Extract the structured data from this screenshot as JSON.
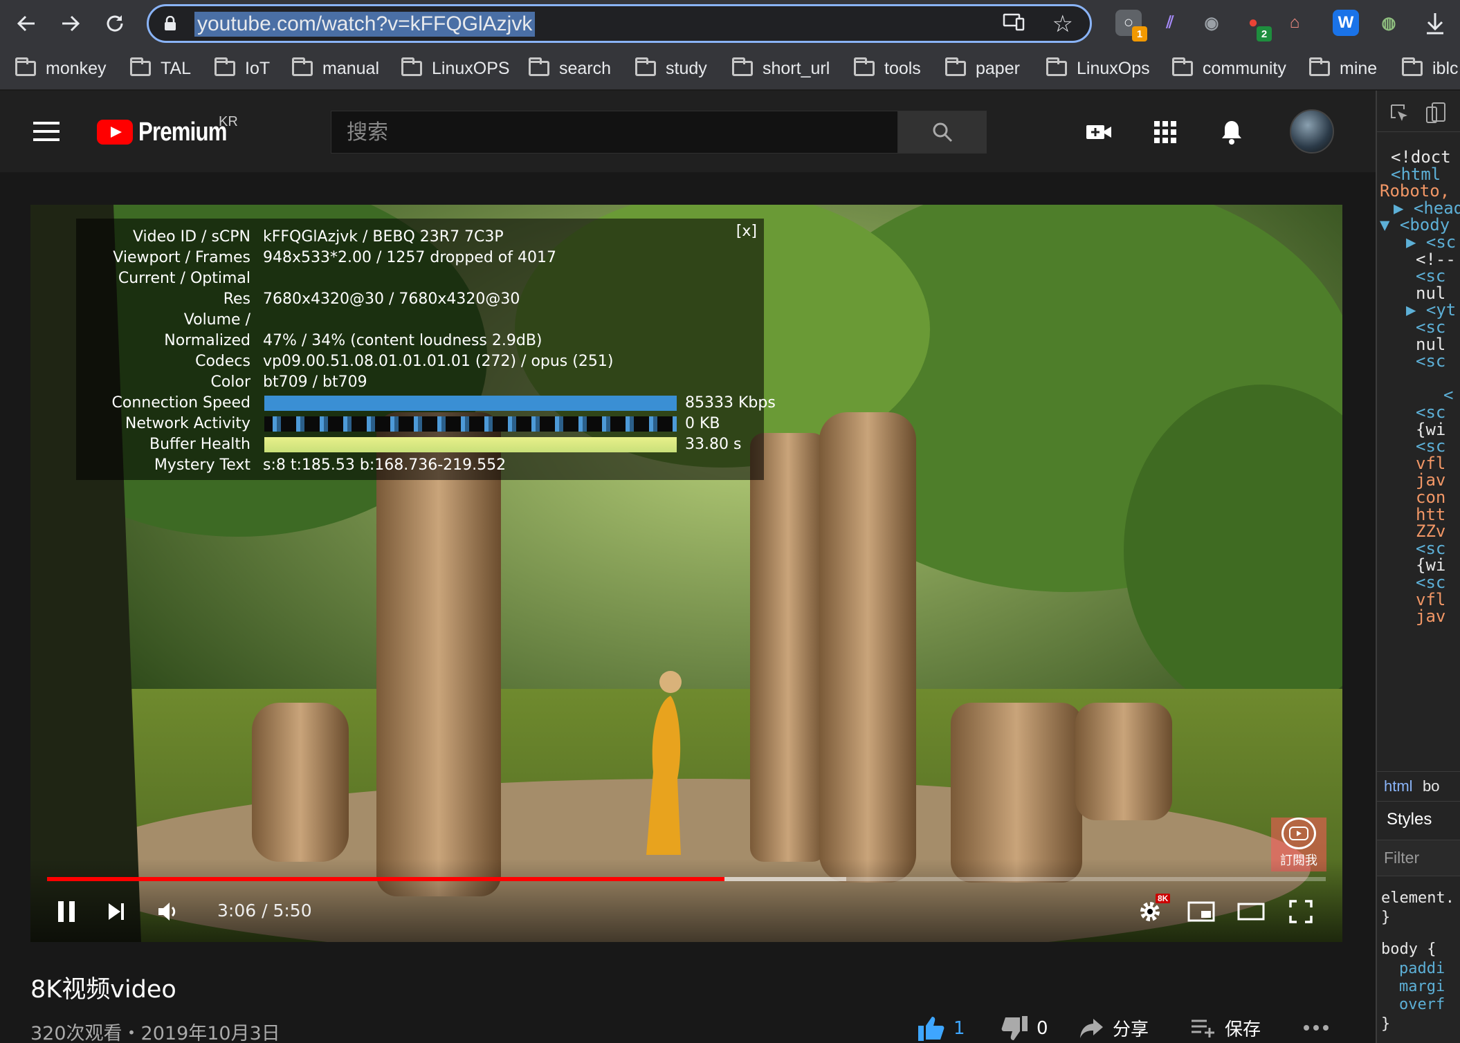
{
  "browser": {
    "url": "youtube.com/watch?v=kFFQGlAzjvk",
    "extensions": [
      {
        "icon": "key-search-icon",
        "badge": "1",
        "badge_color": "#f29900"
      },
      {
        "icon": "stripes-icon",
        "badge": ""
      },
      {
        "icon": "camera-icon",
        "badge": ""
      },
      {
        "icon": "balloon-icon",
        "badge": "2",
        "badge_color": "#1e8e3e"
      },
      {
        "icon": "cat-icon",
        "badge": ""
      },
      {
        "icon": "w-icon",
        "badge": ""
      },
      {
        "icon": "tea-icon",
        "badge": ""
      }
    ],
    "bookmarks": [
      "monkey",
      "TAL",
      "IoT",
      "manual",
      "LinuxOPS",
      "search",
      "study",
      "short_url",
      "tools",
      "paper",
      "LinuxOps",
      "community",
      "mine",
      "iblc"
    ]
  },
  "masthead": {
    "logo_text": "Premium",
    "region": "KR",
    "search_placeholder": "搜索"
  },
  "stats": {
    "close": "[x]",
    "rows": [
      {
        "label": "Video ID / sCPN",
        "value": "kFFQGlAzjvk / BEBQ 23R7 7C3P"
      },
      {
        "label": "Viewport / Frames",
        "value": "948x533*2.00 / 1257 dropped of 4017"
      },
      {
        "label": "Current / Optimal",
        "value": ""
      },
      {
        "label": "Res",
        "value": "7680x4320@30 / 7680x4320@30"
      },
      {
        "label": "Volume /",
        "value": ""
      },
      {
        "label": "Normalized",
        "value": "47% / 34% (content loudness 2.9dB)"
      },
      {
        "label": "Codecs",
        "value": "vp09.00.51.08.01.01.01.01 (272) / opus (251)"
      },
      {
        "label": "Color",
        "value": "bt709 / bt709"
      },
      {
        "label": "Connection Speed",
        "value": "85333 Kbps"
      },
      {
        "label": "Network Activity",
        "value": "0 KB"
      },
      {
        "label": "Buffer Health",
        "value": "33.80 s"
      },
      {
        "label": "Mystery Text",
        "value": "s:8 t:185.53 b:168.736-219.552"
      }
    ]
  },
  "player": {
    "time": "3:06 / 5:50",
    "played_fraction": 0.53,
    "buffered_fraction": 0.625,
    "quality_badge": "8K",
    "watermark_text": "訂閱我",
    "accent": "#ff0000"
  },
  "video": {
    "title": "8K视频video",
    "meta": "320次观看・2019年10月3日",
    "likes": "1",
    "dislikes": "0",
    "share": "分享",
    "save": "保存"
  },
  "devtools": {
    "lines": [
      {
        "text": "<!doct",
        "cls": "txt"
      },
      {
        "text": "<html",
        "cls": "tag"
      },
      {
        "text": "Roboto,",
        "cls": "str"
      },
      {
        "text": "▶ <head",
        "cls": "tag"
      },
      {
        "text": "▼ <body",
        "cls": "tag"
      },
      {
        "text": "▶ <sc",
        "cls": "tag"
      },
      {
        "text": "<!--",
        "cls": "txt"
      },
      {
        "text": "<sc",
        "cls": "tag"
      },
      {
        "text": "nul",
        "cls": "txt"
      },
      {
        "text": "▶ <yt",
        "cls": "tag"
      },
      {
        "text": "<sc",
        "cls": "tag"
      },
      {
        "text": "nul",
        "cls": "txt"
      },
      {
        "text": "<sc",
        "cls": "tag"
      },
      {
        "text": "",
        "cls": "txt"
      },
      {
        "text": "<",
        "cls": "tag"
      },
      {
        "text": "<sc",
        "cls": "tag"
      },
      {
        "text": "{wi",
        "cls": "txt"
      },
      {
        "text": "<sc",
        "cls": "tag"
      },
      {
        "text": "vfl",
        "cls": "str"
      },
      {
        "text": "jav",
        "cls": "str"
      },
      {
        "text": "con",
        "cls": "str"
      },
      {
        "text": "htt",
        "cls": "str"
      },
      {
        "text": "ZZv",
        "cls": "str"
      },
      {
        "text": "<sc",
        "cls": "tag"
      },
      {
        "text": "{wi",
        "cls": "txt"
      },
      {
        "text": "<sc",
        "cls": "tag"
      },
      {
        "text": "vfl",
        "cls": "str"
      },
      {
        "text": "jav",
        "cls": "str"
      }
    ],
    "crumbs": [
      "html",
      "bo"
    ],
    "styles_tab": "Styles",
    "filter_placeholder": "Filter",
    "css_lines": [
      "element.",
      "}",
      "body {",
      "paddi",
      "margi",
      "overf",
      "}"
    ]
  }
}
